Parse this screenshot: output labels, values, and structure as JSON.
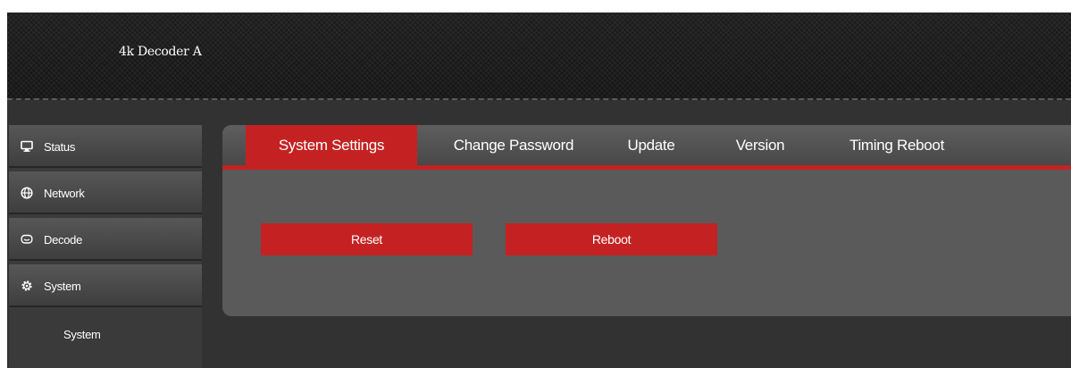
{
  "header": {
    "title": "4k Decoder  A"
  },
  "sidebar": {
    "items": [
      {
        "label": "Status",
        "icon": "monitor-icon"
      },
      {
        "label": "Network",
        "icon": "globe-icon"
      },
      {
        "label": "Decode",
        "icon": "decode-icon"
      },
      {
        "label": "System",
        "icon": "gear-icon"
      }
    ],
    "sub_items": [
      {
        "label": "System"
      }
    ]
  },
  "tabs": [
    {
      "label": "System Settings",
      "active": true
    },
    {
      "label": "Change Password",
      "active": false
    },
    {
      "label": "Update",
      "active": false
    },
    {
      "label": "Version",
      "active": false
    },
    {
      "label": "Timing Reboot",
      "active": false
    }
  ],
  "actions": {
    "reset_label": "Reset",
    "reboot_label": "Reboot"
  },
  "colors": {
    "accent": "#c42222",
    "background": "#323232",
    "panel": "#5a5a5a"
  }
}
